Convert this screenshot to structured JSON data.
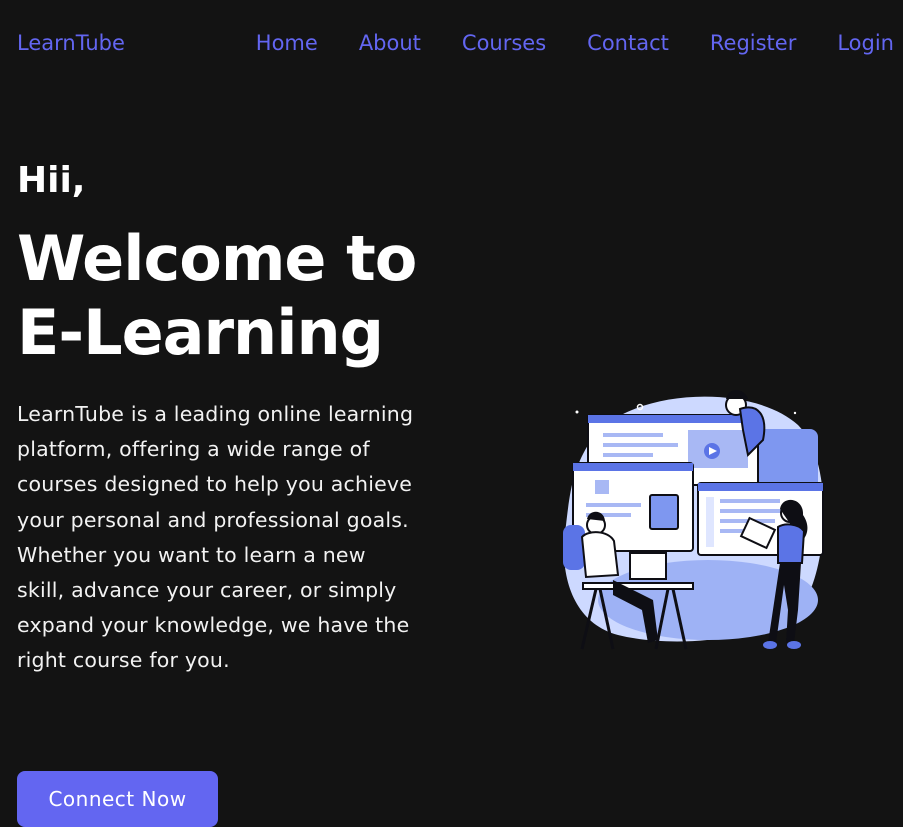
{
  "brand": {
    "name": "LearnTube"
  },
  "nav": {
    "items": [
      "Home",
      "About",
      "Courses",
      "Contact",
      "Register",
      "Login"
    ]
  },
  "hero": {
    "greeting": "Hii,",
    "headline_line1": "Welcome to",
    "headline_line2": "E-Learning",
    "description": "LearnTube is a leading online learning platform, offering a wide range of courses designed to help you achieve your personal and professional goals. Whether you want to learn a new skill, advance your career, or simply expand your knowledge, we have the right course for you.",
    "cta_label": "Connect Now"
  },
  "colors": {
    "background": "#131313",
    "accent": "#6366f1",
    "text": "#ffffff"
  },
  "icons": [
    "e-learning-illustration"
  ]
}
